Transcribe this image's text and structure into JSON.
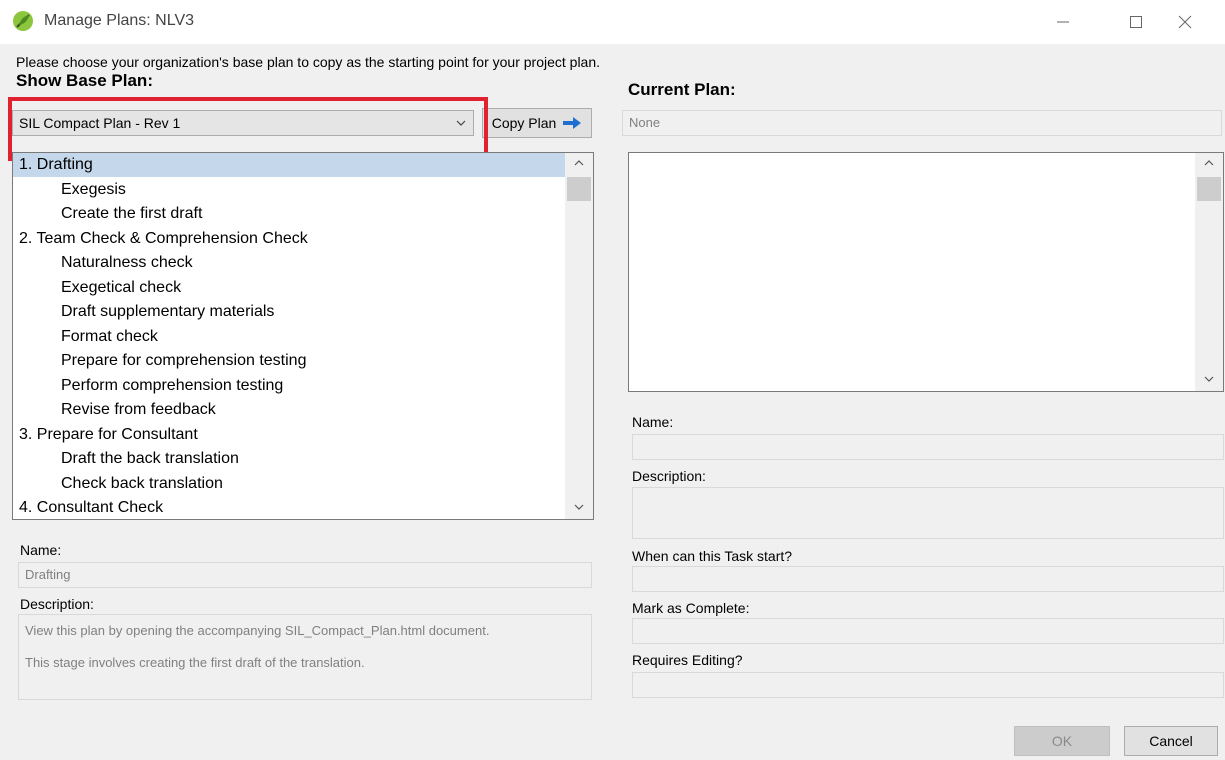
{
  "window": {
    "title": "Manage Plans: NLV3"
  },
  "instruction": "Please choose your organization's base plan to copy as the starting point for your project plan.",
  "base_plan": {
    "label": "Show Base Plan:",
    "selected": "SIL Compact Plan - Rev 1",
    "copy_button": "Copy Plan",
    "items": [
      {
        "text": "1. Drafting",
        "level": 1,
        "selected": true
      },
      {
        "text": "Exegesis",
        "level": 2
      },
      {
        "text": "Create the first draft",
        "level": 2
      },
      {
        "text": "2. Team Check & Comprehension Check",
        "level": 1
      },
      {
        "text": "Naturalness check",
        "level": 2
      },
      {
        "text": "Exegetical check",
        "level": 2
      },
      {
        "text": "Draft supplementary materials",
        "level": 2
      },
      {
        "text": "Format check",
        "level": 2
      },
      {
        "text": "Prepare for comprehension testing",
        "level": 2
      },
      {
        "text": "Perform comprehension testing",
        "level": 2
      },
      {
        "text": "Revise from feedback",
        "level": 2
      },
      {
        "text": "3. Prepare for Consultant",
        "level": 1
      },
      {
        "text": "Draft the back translation",
        "level": 2
      },
      {
        "text": "Check back translation",
        "level": 2
      },
      {
        "text": "4. Consultant Check",
        "level": 1
      }
    ],
    "name_label": "Name:",
    "name_value": "Drafting",
    "description_label": "Description:",
    "description_line1": "View this plan by opening the accompanying SIL_Compact_Plan.html document.",
    "description_line2": "This stage involves creating the first draft of the translation."
  },
  "current_plan": {
    "label": "Current Plan:",
    "value": "None",
    "name_label": "Name:",
    "description_label": "Description:",
    "start_label": "When can this Task start?",
    "complete_label": "Mark as Complete:",
    "editing_label": "Requires Editing?"
  },
  "buttons": {
    "ok": "OK",
    "cancel": "Cancel"
  },
  "colors": {
    "highlight": "#e0212f",
    "selection": "#c5d7ea",
    "arrow": "#1f6fd1"
  }
}
